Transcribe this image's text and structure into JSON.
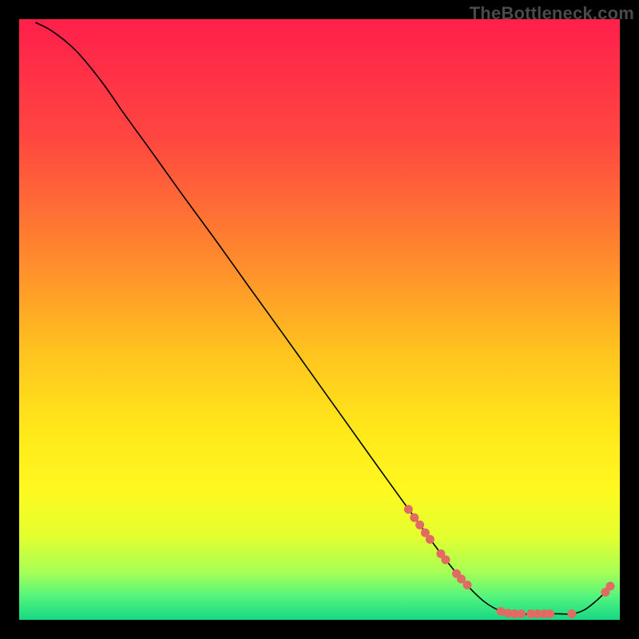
{
  "watermark": "TheBottleneck.com",
  "chart_data": {
    "type": "line",
    "title": "",
    "xlabel": "",
    "ylabel": "",
    "xlim": [
      0,
      100
    ],
    "ylim": [
      0,
      100
    ],
    "background_gradient": {
      "stops": [
        {
          "offset": 0.0,
          "color": "#ff1f4b"
        },
        {
          "offset": 0.2,
          "color": "#ff4740"
        },
        {
          "offset": 0.4,
          "color": "#ff8a2d"
        },
        {
          "offset": 0.55,
          "color": "#ffc21f"
        },
        {
          "offset": 0.68,
          "color": "#ffe71a"
        },
        {
          "offset": 0.78,
          "color": "#fff81f"
        },
        {
          "offset": 0.86,
          "color": "#e4ff2e"
        },
        {
          "offset": 0.92,
          "color": "#a8ff55"
        },
        {
          "offset": 0.96,
          "color": "#55f57d"
        },
        {
          "offset": 1.0,
          "color": "#17d884"
        }
      ]
    },
    "series": [
      {
        "name": "bottleneck-curve",
        "color": "#000000",
        "points": [
          {
            "x": 2.8,
            "y": 99.4
          },
          {
            "x": 5.5,
            "y": 98.0
          },
          {
            "x": 9.5,
            "y": 94.7
          },
          {
            "x": 13.8,
            "y": 89.5
          },
          {
            "x": 17.5,
            "y": 84.2
          },
          {
            "x": 22.0,
            "y": 78.0
          },
          {
            "x": 27.0,
            "y": 71.0
          },
          {
            "x": 32.5,
            "y": 63.5
          },
          {
            "x": 38.0,
            "y": 55.8
          },
          {
            "x": 43.5,
            "y": 48.2
          },
          {
            "x": 49.0,
            "y": 40.5
          },
          {
            "x": 54.5,
            "y": 32.8
          },
          {
            "x": 60.0,
            "y": 25.1
          },
          {
            "x": 65.5,
            "y": 17.5
          },
          {
            "x": 71.0,
            "y": 10.0
          },
          {
            "x": 75.5,
            "y": 4.8
          },
          {
            "x": 79.0,
            "y": 2.0
          },
          {
            "x": 82.5,
            "y": 1.0
          },
          {
            "x": 86.0,
            "y": 1.0
          },
          {
            "x": 89.5,
            "y": 1.0
          },
          {
            "x": 92.0,
            "y": 1.0
          },
          {
            "x": 94.0,
            "y": 1.6
          },
          {
            "x": 96.0,
            "y": 3.1
          },
          {
            "x": 98.0,
            "y": 5.0
          }
        ]
      }
    ],
    "markers": {
      "name": "highlight-points",
      "color": "#e16a63",
      "radius": 5.5,
      "points": [
        {
          "x": 64.8,
          "y": 18.4
        },
        {
          "x": 65.8,
          "y": 17.0
        },
        {
          "x": 66.7,
          "y": 15.8
        },
        {
          "x": 67.6,
          "y": 14.5
        },
        {
          "x": 68.4,
          "y": 13.4
        },
        {
          "x": 70.2,
          "y": 11.0
        },
        {
          "x": 71.0,
          "y": 10.0
        },
        {
          "x": 72.8,
          "y": 7.7
        },
        {
          "x": 73.6,
          "y": 6.8
        },
        {
          "x": 74.6,
          "y": 5.8
        },
        {
          "x": 80.2,
          "y": 1.4
        },
        {
          "x": 81.4,
          "y": 1.1
        },
        {
          "x": 82.5,
          "y": 1.0
        },
        {
          "x": 83.6,
          "y": 1.0
        },
        {
          "x": 85.2,
          "y": 1.0
        },
        {
          "x": 86.3,
          "y": 1.0
        },
        {
          "x": 87.4,
          "y": 1.0
        },
        {
          "x": 88.4,
          "y": 1.0
        },
        {
          "x": 92.0,
          "y": 1.0
        },
        {
          "x": 97.6,
          "y": 4.6
        },
        {
          "x": 98.4,
          "y": 5.6
        }
      ]
    }
  }
}
